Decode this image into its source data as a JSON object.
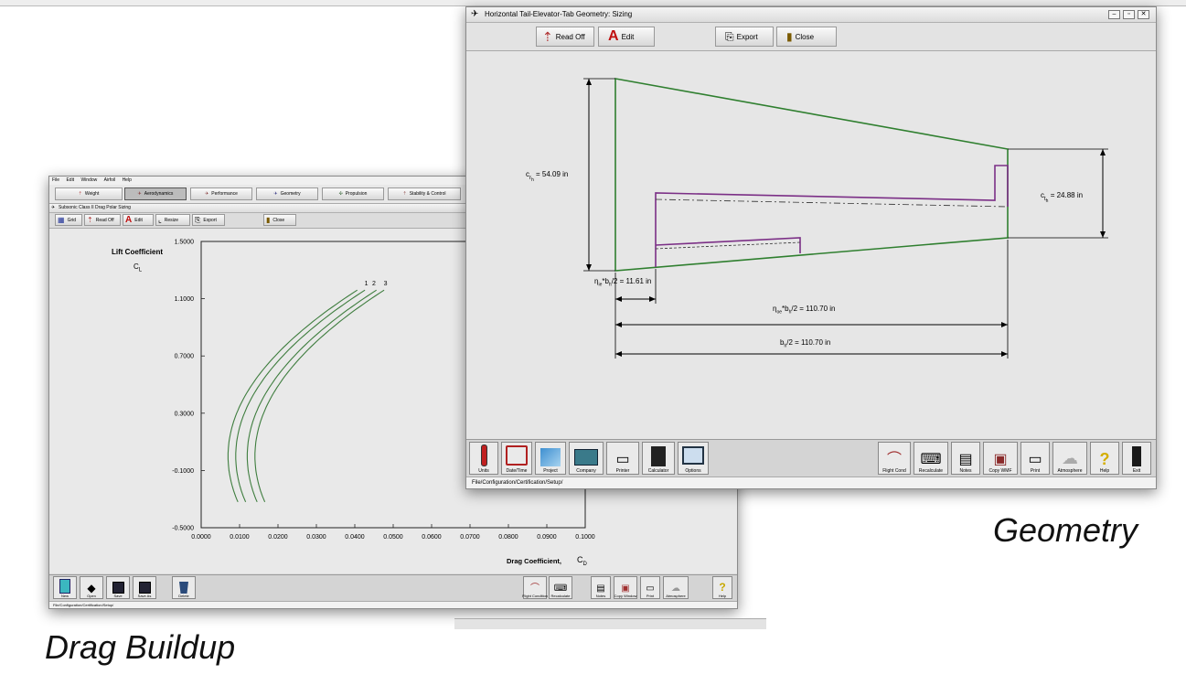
{
  "back_window": {
    "menu": [
      "File",
      "Edit",
      "Window",
      "Airfoil",
      "Help"
    ],
    "modules": [
      "Weight",
      "Aerodynamics",
      "Performance",
      "Geometry",
      "Propulsion",
      "Stability & Control"
    ],
    "title": "Subsonic Class II Drag Polar Sizing",
    "toolbar": {
      "grid": "Grid",
      "read_off": "Read Off",
      "edit": "Edit",
      "resize": "Resize",
      "export": "Export",
      "close": "Close"
    },
    "bottom_buttons": [
      "New",
      "Open",
      "Save",
      "Save As",
      "Delete"
    ],
    "bottom_right_buttons": [
      "Flight Condition",
      "Recalculate",
      "Notes",
      "Copy Window",
      "Print",
      "Atmosphere",
      "Help"
    ],
    "tabs": "File/Configuration/Certification/Setup/"
  },
  "chart_data": {
    "type": "line",
    "ylabel": "Lift Coefficient",
    "ysymbol": "C",
    "ysymbol_sub": "L",
    "xlabel": "Drag Coefficient,",
    "xsymbol": "C",
    "xsymbol_sub": "D",
    "xlim": [
      0.0,
      0.1
    ],
    "ylim": [
      -0.5,
      1.5
    ],
    "x_ticks": [
      "0.0000",
      "0.0100",
      "0.0200",
      "0.0300",
      "0.0400",
      "0.0500",
      "0.0600",
      "0.0700",
      "0.0800",
      "0.0900",
      "0.1000"
    ],
    "y_ticks": [
      "1.5000",
      "1.1000",
      "0.7000",
      "0.3000",
      "-0.1000",
      "-0.5000"
    ],
    "series": [
      {
        "name": "1",
        "cd0": 0.007,
        "k": 0.025
      },
      {
        "name": "2",
        "cd0": 0.009,
        "k": 0.025
      },
      {
        "name": "3",
        "cd0": 0.012,
        "k": 0.025
      },
      {
        "cd0": 0.014,
        "k": 0.025
      }
    ],
    "curve_color": "#3e7d3e"
  },
  "front_window": {
    "title": "Horizontal Tail-Elevator-Tab Geometry: Sizing",
    "toolbar": {
      "read_off": "Read Off",
      "edit": "Edit",
      "export": "Export",
      "close": "Close"
    },
    "annotations": {
      "c_root_main": "c",
      "c_root_sub": "r",
      "c_root_subsub": "h",
      "c_root_value": "= 54.09 in",
      "c_tip_main": "c",
      "c_tip_sub": "t",
      "c_tip_subsub": "h",
      "c_tip_value": "= 24.88 in",
      "eta_i_main": "η",
      "eta_i_sub": "ie",
      "eta_i_value": "*b",
      "eta_i_b_sub": "h",
      "eta_i_rest": "/2 = 11.61 in",
      "eta_o_main": "η",
      "eta_o_sub": "oe",
      "eta_o_value": "*b",
      "eta_o_b_sub": "h",
      "eta_o_rest": "/2 = 110.70 in",
      "b_main": "b",
      "b_sub": "h",
      "b_rest": "/2 = 110.70 in"
    },
    "outline_color": "#2f7f2f",
    "elevator_color": "#7b2f86",
    "bottom_left_buttons": [
      "Units",
      "Date/Time",
      "Project",
      "Company",
      "Printer",
      "Calculator",
      "Options"
    ],
    "bottom_right_buttons": [
      "Flight Cond",
      "Recalculate",
      "Notes",
      "Copy WMF",
      "Print",
      "Atmosphere",
      "Help",
      "Exit"
    ],
    "tabs": "File/Configuration/Certification/Setup/"
  },
  "captions": {
    "geometry": "Geometry",
    "drag": "Drag Buildup"
  }
}
